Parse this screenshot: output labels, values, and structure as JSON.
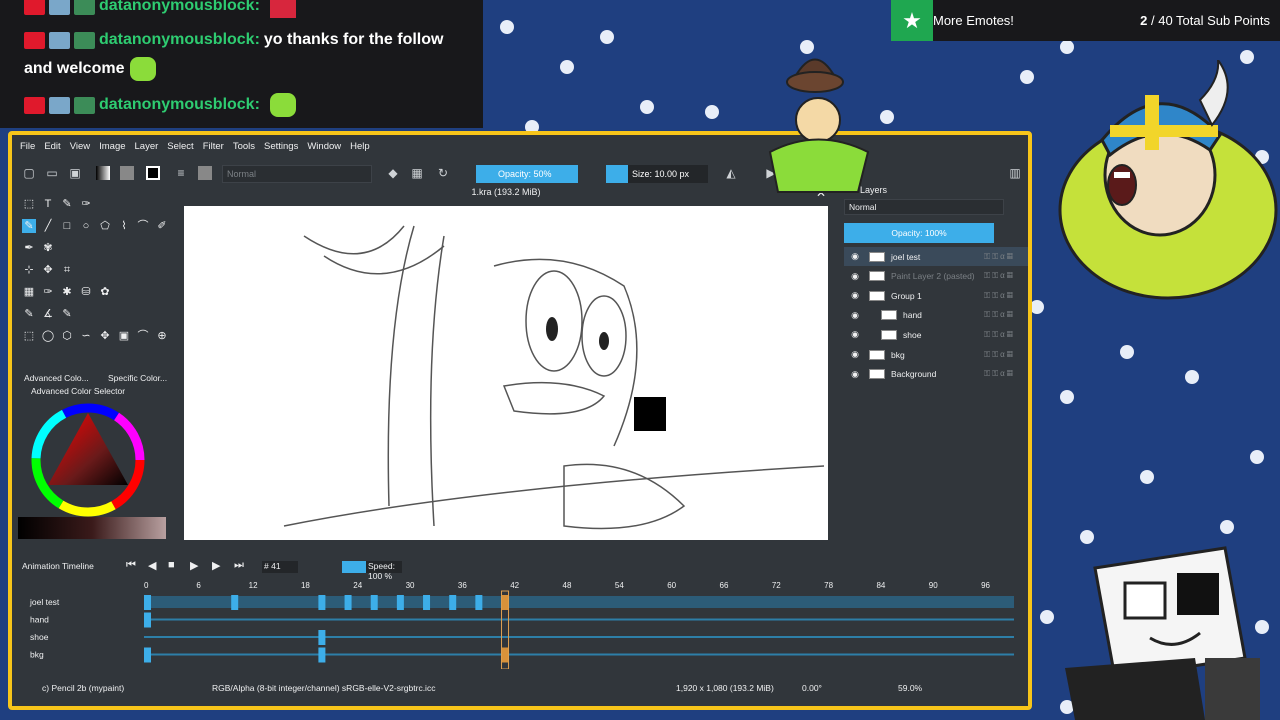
{
  "chat": {
    "lines": [
      {
        "user": "datanonymousblock:",
        "msg": ""
      },
      {
        "user": "datanonymousblock:",
        "msg": "yo thanks for the follow"
      },
      {
        "continuation": "and welcome"
      },
      {
        "user": "datanonymousblock:",
        "msg": ""
      }
    ]
  },
  "goal": {
    "label": "More Emotes!",
    "count_current": "2",
    "count_rest": " / 40 Total Sub Points"
  },
  "krita": {
    "menu": [
      "File",
      "Edit",
      "View",
      "Image",
      "Layer",
      "Select",
      "Filter",
      "Tools",
      "Settings",
      "Window",
      "Help"
    ],
    "blend_mode": "Normal",
    "opacity_label": "Opacity: 50%",
    "size_label": "Size: 10.00 px",
    "document_title": "1.kra (193.2 MiB)",
    "panels": {
      "advanced_tab": "Advanced Colo...",
      "specific_tab": "Specific Color...",
      "selector_title": "Advanced Color Selector"
    },
    "layers_panel": {
      "title": "Layers",
      "blend_mode": "Normal",
      "opacity_label": "Opacity:  100%",
      "layers": [
        {
          "name": "joel test",
          "selected": true
        },
        {
          "name": "Paint Layer 2 (pasted)",
          "selected": false
        },
        {
          "name": "Group 1",
          "selected": false
        },
        {
          "name": "hand",
          "selected": false
        },
        {
          "name": "shoe",
          "selected": false
        },
        {
          "name": "bkg",
          "selected": false
        },
        {
          "name": "Background",
          "selected": false
        }
      ]
    },
    "timeline": {
      "title": "Animation Timeline",
      "frame_label": "# 41",
      "speed_label": "Speed: 100 %",
      "frame_ticks": [
        "0",
        "6",
        "12",
        "18",
        "24",
        "30",
        "36",
        "42",
        "48",
        "54",
        "60",
        "66",
        "72",
        "78",
        "84",
        "90",
        "96"
      ],
      "rows": [
        "joel test",
        "hand",
        "shoe",
        "bkg"
      ],
      "current_frame": 41,
      "keyframes": {
        "joel test": [
          0,
          10,
          20,
          23,
          26,
          29,
          32,
          35,
          38,
          41
        ],
        "hand": [
          0
        ],
        "shoe": [
          20
        ],
        "bkg": [
          0,
          20,
          41
        ]
      }
    },
    "status": {
      "brush": "c) Pencil 2b (mypaint)",
      "colorspace": "RGB/Alpha (8-bit integer/channel)  sRGB-elle-V2-srgbtrc.icc",
      "dimensions": "1,920 x 1,080 (193.2 MiB)",
      "rotation": "0.00°",
      "zoom": "59.0%"
    }
  }
}
